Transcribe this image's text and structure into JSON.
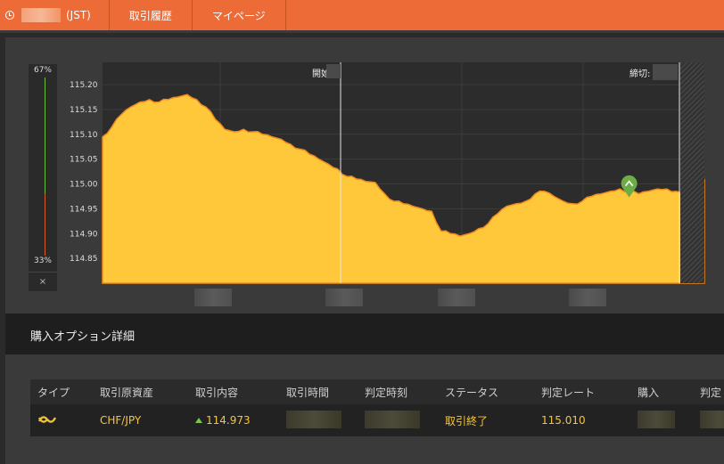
{
  "nav": {
    "time_suffix": "(JST)",
    "items": [
      "取引履歴",
      "マイページ"
    ]
  },
  "gauge": {
    "top": "67%",
    "bottom": "33%",
    "close": "×"
  },
  "chart_data": {
    "type": "area",
    "ylim": [
      114.8,
      115.245
    ],
    "y_ticks": [
      "115.20",
      "115.15",
      "115.10",
      "115.05",
      "115.00",
      "114.95",
      "114.90",
      "114.85"
    ],
    "markers": {
      "start_label": "開始",
      "end_label": "締切:"
    },
    "color": "#ffc83a",
    "values": [
      115.095,
      115.115,
      115.14,
      115.155,
      115.165,
      115.17,
      115.165,
      115.17,
      115.175,
      115.18,
      115.17,
      115.155,
      115.13,
      115.11,
      115.105,
      115.11,
      115.105,
      115.1,
      115.095,
      115.09,
      115.08,
      115.07,
      115.06,
      115.05,
      115.04,
      115.03,
      115.015,
      115.01,
      115.005,
      115.003,
      114.98,
      114.965,
      114.96,
      114.955,
      114.95,
      114.945,
      114.905,
      114.9,
      114.895,
      114.9,
      114.91,
      114.92,
      114.94,
      114.955,
      114.96,
      114.965,
      114.98,
      114.985,
      114.975,
      114.965,
      114.96,
      114.965,
      114.975,
      114.98,
      114.985,
      114.99,
      114.985,
      114.98,
      114.985,
      114.99,
      114.99,
      114.985,
      114.975,
      114.97,
      115.01
    ],
    "point_value": 114.973,
    "point_index": 56
  },
  "details": {
    "title": "購入オプション詳細"
  },
  "table": {
    "headers": [
      "タイプ",
      "取引原資産",
      "取引内容",
      "取引時間",
      "判定時刻",
      "ステータス",
      "判定レート",
      "購入",
      "判定"
    ],
    "row": {
      "asset": "CHF/JPY",
      "content": "114.973",
      "status": "取引終了",
      "rate": "115.010"
    }
  }
}
